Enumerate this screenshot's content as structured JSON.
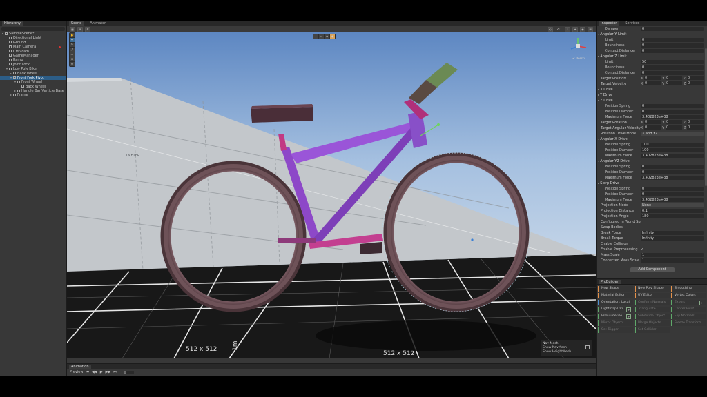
{
  "hierarchy": {
    "tab": "Hierarchy",
    "items": [
      {
        "label": "SampleScene*",
        "depth": 0,
        "arrow": "▾",
        "selected": false
      },
      {
        "label": "Directional Light",
        "depth": 1,
        "arrow": "",
        "selected": false
      },
      {
        "label": "Ground",
        "depth": 1,
        "arrow": "",
        "selected": false
      },
      {
        "label": "Main Camera",
        "depth": 1,
        "arrow": "",
        "selected": false,
        "flag": true
      },
      {
        "label": "CM vcam1",
        "depth": 1,
        "arrow": "",
        "selected": false
      },
      {
        "label": "GameManager",
        "depth": 1,
        "arrow": "",
        "selected": false
      },
      {
        "label": "Ramp",
        "depth": 1,
        "arrow": "",
        "selected": false
      },
      {
        "label": "Joint Lock",
        "depth": 1,
        "arrow": "",
        "selected": false
      },
      {
        "label": "Low Poly Bike",
        "depth": 1,
        "arrow": "▾",
        "selected": false
      },
      {
        "label": "Back Wheel",
        "depth": 2,
        "arrow": "▸",
        "selected": false
      },
      {
        "label": "Front Fork Pivot",
        "depth": 2,
        "arrow": "▾",
        "selected": true
      },
      {
        "label": "Front Wheel",
        "depth": 3,
        "arrow": "▾",
        "selected": false
      },
      {
        "label": "Back Wheel",
        "depth": 4,
        "arrow": "",
        "selected": false
      },
      {
        "label": "Handle Bar Verticle Base",
        "depth": 3,
        "arrow": "▸",
        "selected": false
      },
      {
        "label": "Frame",
        "depth": 2,
        "arrow": "▸",
        "selected": false
      }
    ]
  },
  "scene": {
    "tabs": [
      "Scene",
      "Animator"
    ],
    "toolbar_right": [
      "2D",
      "◐",
      "♪",
      "✦",
      "◉",
      "⊞"
    ],
    "persp_label": "< Persp",
    "grid_label": "512 x 512",
    "grid_label_b": "512 x 512",
    "meter_label": "1METER",
    "meter_vertical": "1m",
    "navmesh": {
      "title": "Nav Mesh",
      "show_navmesh": "Show NavMesh",
      "show_heightmesh": "Show HeightMesh"
    }
  },
  "animation": {
    "tab": "Animation",
    "preview": "Preview",
    "controls": [
      "⏮",
      "◀◀",
      "▶",
      "▶▶",
      "⏭"
    ],
    "frame": "0"
  },
  "inspector": {
    "tabs": [
      "Inspector",
      "Services"
    ],
    "rows": [
      {
        "t": "sub",
        "label": "Damper",
        "val": "0"
      },
      {
        "t": "sec open",
        "label": "Angular Y Limit"
      },
      {
        "t": "sub",
        "label": "Limit",
        "val": "0"
      },
      {
        "t": "sub",
        "label": "Bounciness",
        "val": "0"
      },
      {
        "t": "sub",
        "label": "Contact Distance",
        "val": "0"
      },
      {
        "t": "sec open",
        "label": "Angular Z Limit"
      },
      {
        "t": "sub",
        "label": "Limit",
        "val": "50"
      },
      {
        "t": "sub",
        "label": "Bounciness",
        "val": "0"
      },
      {
        "t": "sub",
        "label": "Contact Distance",
        "val": "0"
      },
      {
        "t": "plain",
        "label": "Target Position",
        "xyz": [
          "0",
          "0",
          "0"
        ]
      },
      {
        "t": "plain",
        "label": "Target Velocity",
        "xyz": [
          "0",
          "0",
          "0"
        ]
      },
      {
        "t": "sec",
        "label": "X Drive"
      },
      {
        "t": "sec",
        "label": "Y Drive"
      },
      {
        "t": "sec open",
        "label": "Z Drive"
      },
      {
        "t": "sub",
        "label": "Position Spring",
        "val": "0"
      },
      {
        "t": "sub",
        "label": "Position Damper",
        "val": "0"
      },
      {
        "t": "sub",
        "label": "Maximum Force",
        "val": "3.402823e+38"
      },
      {
        "t": "plain",
        "label": "Target Rotation",
        "xyz": [
          "0",
          "0",
          "0"
        ]
      },
      {
        "t": "plain",
        "label": "Target Angular Velocity",
        "xyz": [
          "0",
          "0",
          "0"
        ]
      },
      {
        "t": "plain",
        "label": "Rotation Drive Mode",
        "val": "X and YZ",
        "dd": true
      },
      {
        "t": "sec open",
        "label": "Angular X Drive"
      },
      {
        "t": "sub",
        "label": "Position Spring",
        "val": "100"
      },
      {
        "t": "sub",
        "label": "Position Damper",
        "val": "100"
      },
      {
        "t": "sub",
        "label": "Maximum Force",
        "val": "3.402823e+38"
      },
      {
        "t": "sec open",
        "label": "Angular YZ Drive"
      },
      {
        "t": "sub",
        "label": "Position Spring",
        "val": "0"
      },
      {
        "t": "sub",
        "label": "Position Damper",
        "val": "0"
      },
      {
        "t": "sub",
        "label": "Maximum Force",
        "val": "3.402823e+38"
      },
      {
        "t": "sec",
        "label": "Slerp Drive"
      },
      {
        "t": "sub",
        "label": "Position Spring",
        "val": "0"
      },
      {
        "t": "sub",
        "label": "Position Damper",
        "val": "0"
      },
      {
        "t": "sub",
        "label": "Maximum Force",
        "val": "3.402823e+38"
      },
      {
        "t": "plain",
        "label": "Projection Mode",
        "val": "None",
        "dd": true
      },
      {
        "t": "plain",
        "label": "Projection Distance",
        "val": "0.1"
      },
      {
        "t": "plain",
        "label": "Projection Angle",
        "val": "180"
      },
      {
        "t": "plain",
        "label": "Configured In World Spa",
        "chk": ""
      },
      {
        "t": "plain",
        "label": "Swap Bodies",
        "chk": ""
      },
      {
        "t": "plain",
        "label": "Break Force",
        "val": "Infinity"
      },
      {
        "t": "plain",
        "label": "Break Torque",
        "val": "Infinity"
      },
      {
        "t": "plain",
        "label": "Enable Collision",
        "chk": ""
      },
      {
        "t": "plain",
        "label": "Enable Preprocessing",
        "chk": "✓"
      },
      {
        "t": "plain",
        "label": "Mass Scale",
        "val": "1"
      },
      {
        "t": "plain",
        "label": "Connected Mass Scale",
        "val": "1"
      }
    ],
    "add_component": "Add Component"
  },
  "probuilder": {
    "tab": "ProBuilder",
    "buttons": [
      {
        "label": "New Shape",
        "c": "orange"
      },
      {
        "label": "New Poly Shape",
        "c": "orange"
      },
      {
        "label": "Smoothing",
        "c": "orange"
      },
      {
        "label": "Material Editor",
        "c": "orange"
      },
      {
        "label": "UV Editor",
        "c": "orange"
      },
      {
        "label": "Vertex Colors",
        "c": "orange"
      },
      {
        "label": "Orientation: Local",
        "c": "blue"
      },
      {
        "label": "Conform Normals",
        "c": "green dim"
      },
      {
        "label": "Export",
        "c": "green dim",
        "plus": true
      },
      {
        "label": "Lightmap UVs",
        "c": "green",
        "plus": true
      },
      {
        "label": "Triangulate",
        "c": "green dim"
      },
      {
        "label": "Center Pivot",
        "c": "green dim"
      },
      {
        "label": "ProBuilderize",
        "c": "green",
        "plus": true
      },
      {
        "label": "Subdivide Object",
        "c": "green dim"
      },
      {
        "label": "Flip Normals",
        "c": "green dim"
      },
      {
        "label": "Mirror Objects",
        "c": "green dim"
      },
      {
        "label": "Merge Objects",
        "c": "green dim"
      },
      {
        "label": "Freeze Transform",
        "c": "green dim"
      },
      {
        "label": "Set Trigger",
        "c": "green dim"
      },
      {
        "label": "Set Collider",
        "c": "green dim"
      },
      {
        "label": "",
        "c": ""
      }
    ]
  }
}
